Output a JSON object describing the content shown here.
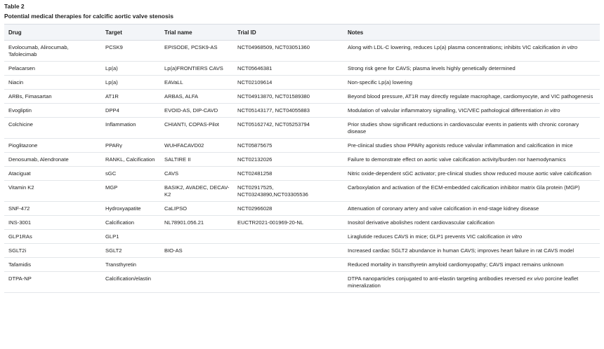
{
  "table_label": "Table 2",
  "caption": "Potential medical therapies for calcific aortic valve stenosis",
  "columns": [
    "Drug",
    "Target",
    "Trial name",
    "Trial ID",
    "Notes"
  ],
  "rows": [
    {
      "drug": "Evolocumab, Alirocumab, Tafolecimab",
      "target": "PCSK9",
      "trial_name": "EPISODE, PCSK9-AS",
      "trial_id": "NCT04968509, NCT03051360",
      "notes": "Along with LDL-C lowering, reduces Lp(a) plasma concentrations; inhibits VIC calcification ",
      "notes_em": "in vitro",
      "notes_after": ""
    },
    {
      "drug": "Pelacarsen",
      "target": "Lp(a)",
      "trial_name": "Lp(a)FRONTIERS CAVS",
      "trial_id": "NCT05646381",
      "notes": "Strong risk gene for CAVS; plasma levels highly genetically determined",
      "notes_em": "",
      "notes_after": ""
    },
    {
      "drug": "Niacin",
      "target": "Lp(a)",
      "trial_name": "EAVaLL",
      "trial_id": "NCT02109614",
      "notes": "Non-specific Lp(a) lowering",
      "notes_em": "",
      "notes_after": ""
    },
    {
      "drug": "ARBs, Fimasartan",
      "target": "AT1R",
      "trial_name": "ARBAS, ALFA",
      "trial_id": "NCT04913870, NCT01589380",
      "notes": "Beyond blood pressure, AT1R may directly regulate macrophage, cardiomyocyte, and VIC pathogenesis",
      "notes_em": "",
      "notes_after": ""
    },
    {
      "drug": "Evogliptin",
      "target": "DPP4",
      "trial_name": "EVOID-AS, DIP-CAVD",
      "trial_id": "NCT05143177, NCT04055883",
      "notes": "Modulation of valvular inflammatory signalling, VIC/VEC pathological differentiation ",
      "notes_em": "in vitro",
      "notes_after": ""
    },
    {
      "drug": "Colchicine",
      "target": "Inflammation",
      "trial_name": "CHIANTI, COPAS-Pilot",
      "trial_id": "NCT05162742, NCT05253794",
      "notes": "Prior studies show significant reductions in cardiovascular events in patients with chronic coronary disease",
      "notes_em": "",
      "notes_after": ""
    },
    {
      "drug": "Pioglitazone",
      "target": "PPARγ",
      "trial_name": "WUHFACAVD02",
      "trial_id": "NCT05875675",
      "notes": "Pre-clinical studies show PPARγ agonists reduce valvular inflammation and calcification in mice",
      "notes_em": "",
      "notes_after": ""
    },
    {
      "drug": "Denosumab, Alendronate",
      "target": "RANKL, Calcification",
      "trial_name": "SALTIRE II",
      "trial_id": "NCT02132026",
      "notes": "Failure to demonstrate effect on aortic valve calcification activity/burden nor haemodynamics",
      "notes_em": "",
      "notes_after": ""
    },
    {
      "drug": "Ataciguat",
      "target": "sGC",
      "trial_name": "CAVS",
      "trial_id": "NCT02481258",
      "notes": "Nitric oxide-dependent sGC activator; pre-clinical studies show reduced mouse aortic valve calcification",
      "notes_em": "",
      "notes_after": ""
    },
    {
      "drug": "Vitamin K2",
      "target": "MGP",
      "trial_name": "BASIK2, AVADEC, DECAV-K2",
      "trial_id": "NCT02917525, NCT03243890,NCT03305536",
      "notes": "Carboxylation and activation of the ECM-embedded calcification inhibitor matrix Gla protein (MGP)",
      "notes_em": "",
      "notes_after": ""
    },
    {
      "drug": "SNF-472",
      "target": "Hydroxyapatite",
      "trial_name": "CaLIPSO",
      "trial_id": "NCT02966028",
      "notes": "Attenuation of coronary artery and valve calcification in end-stage kidney disease",
      "notes_em": "",
      "notes_after": ""
    },
    {
      "drug": "INS-3001",
      "target": "Calcification",
      "trial_name": "NL78901.056.21",
      "trial_id": "EUCTR2021-001969-20-NL",
      "notes": "Inositol derivative abolishes rodent cardiovascular calcification",
      "notes_em": "",
      "notes_after": ""
    },
    {
      "drug": "GLP1RAs",
      "target": "GLP1",
      "trial_name": "",
      "trial_id": "",
      "notes": "Liraglutide reduces CAVS in mice; GLP1 prevents VIC calcification ",
      "notes_em": "in vitro",
      "notes_after": ""
    },
    {
      "drug": "SGLT2i",
      "target": "SGLT2",
      "trial_name": "BIO-AS",
      "trial_id": "",
      "notes": "Increased cardiac SGLT2 abundance in human CAVS; improves heart failure in rat CAVS model",
      "notes_em": "",
      "notes_after": ""
    },
    {
      "drug": "Tafamidis",
      "target": "Transthyretin",
      "trial_name": "",
      "trial_id": "",
      "notes": "Reduced mortality in transthyretin amyloid cardiomyopathy; CAVS impact remains unknown",
      "notes_em": "",
      "notes_after": ""
    },
    {
      "drug": "DTPA-NP",
      "target": "Calcification/elastin",
      "trial_name": "",
      "trial_id": "",
      "notes": "DTPA nanoparticles conjugated to anti-elastin targeting antibodies reversed ",
      "notes_em": "ex vivo",
      "notes_after": " porcine leaflet mineralization"
    }
  ]
}
